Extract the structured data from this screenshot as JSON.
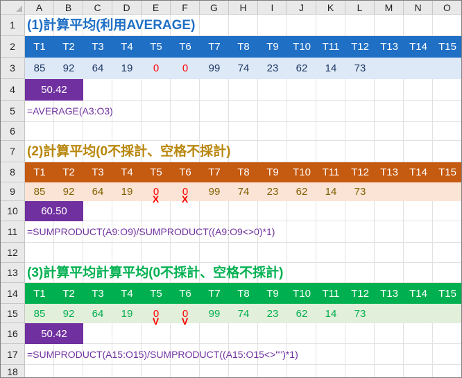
{
  "columns": [
    "A",
    "B",
    "C",
    "D",
    "E",
    "F",
    "G",
    "H",
    "I",
    "J",
    "K",
    "L",
    "M",
    "N",
    "O"
  ],
  "rows": [
    "1",
    "2",
    "3",
    "4",
    "5",
    "6",
    "7",
    "8",
    "9",
    "10",
    "11",
    "12",
    "13",
    "14",
    "15",
    "16",
    "17",
    "18"
  ],
  "headers": [
    "T1",
    "T2",
    "T3",
    "T4",
    "T5",
    "T6",
    "T7",
    "T8",
    "T9",
    "T10",
    "T11",
    "T12",
    "T13",
    "T14",
    "T15"
  ],
  "values": [
    "85",
    "92",
    "64",
    "19",
    "0",
    "0",
    "99",
    "74",
    "23",
    "62",
    "14",
    "73",
    "",
    "",
    ""
  ],
  "sections": [
    {
      "title": "(1)計算平均(利用AVERAGE)",
      "result": "50.42",
      "formula": "=AVERAGE(A3:O3)",
      "marks": [
        "",
        ""
      ],
      "colors": {
        "title": "#1f6fc5",
        "header_bg": "#1f6fc5",
        "values_bg": "#dde9f7",
        "values_text": "#1f3864",
        "zero_text": "#ff0000"
      }
    },
    {
      "title": "(2)計算平均(0不採計、空格不採計)",
      "result": "60.50",
      "formula": "=SUMPRODUCT(A9:O9)/SUMPRODUCT((A9:O9<>0)*1)",
      "marks": [
        "X",
        "X"
      ],
      "colors": {
        "title": "#b8860b",
        "header_bg": "#c55a11",
        "values_bg": "#fbe4d5",
        "values_text": "#806000",
        "zero_text": "#ff0000"
      }
    },
    {
      "title": "(3)計算平均計算平均(0不採計、空格不採計)",
      "result": "50.42",
      "formula": "=SUMPRODUCT(A15:O15)/SUMPRODUCT((A15:O15<>\"\")*1)",
      "marks": [
        "V",
        "V"
      ],
      "colors": {
        "title": "#00b050",
        "header_bg": "#00b050",
        "values_bg": "#e2efda",
        "values_text": "#00b050",
        "zero_text": "#ff0000"
      }
    }
  ]
}
